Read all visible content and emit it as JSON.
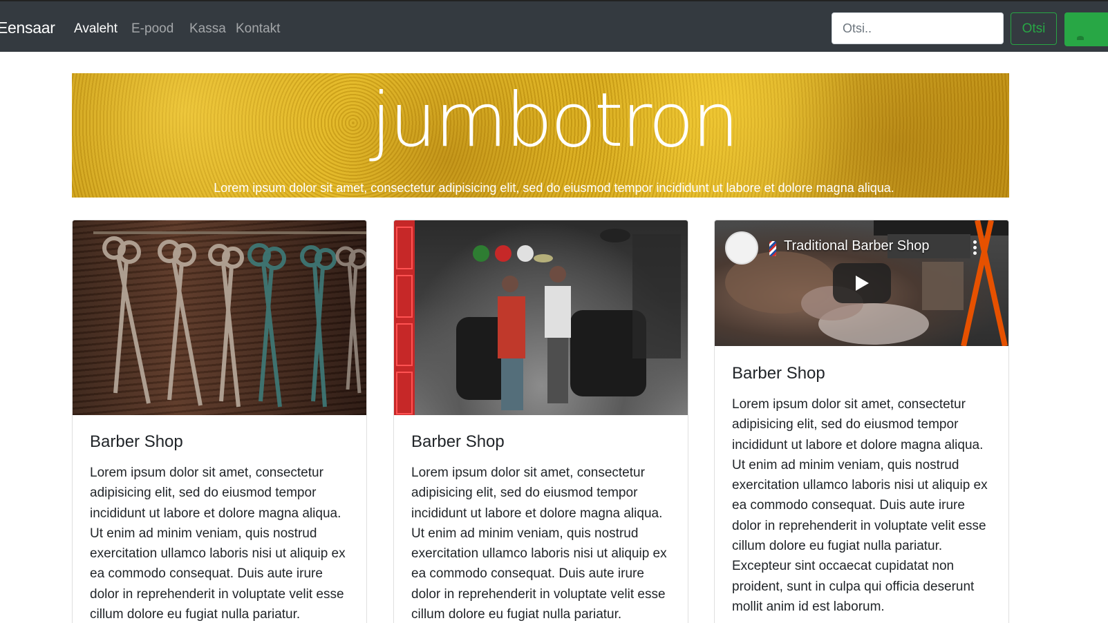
{
  "navbar": {
    "brand": "Eensaar",
    "links": [
      {
        "label": "Avaleht",
        "active": true
      },
      {
        "label": "E-pood",
        "active": false
      },
      {
        "label": "Kassa",
        "active": false
      },
      {
        "label": "Kontakt",
        "active": false
      }
    ],
    "search": {
      "placeholder": "Otsi..",
      "value": ""
    },
    "search_button": "Otsi"
  },
  "jumbotron": {
    "title": "jumbotron",
    "subtitle": "Lorem ipsum dolor sit amet, consectetur adipisicing elit, sed do eiusmod tempor incididunt ut labore et dolore magna aliqua."
  },
  "cards": [
    {
      "media": "image",
      "media_icon": "scissors-image",
      "title": "Barber Shop",
      "text": "Lorem ipsum dolor sit amet, consectetur adipisicing elit, sed do eiusmod tempor incididunt ut labore et dolore magna aliqua. Ut enim ad minim veniam, quis nostrud exercitation ullamco laboris nisi ut aliquip ex ea commodo consequat. Duis aute irure dolor in reprehenderit in voluptate velit esse cillum dolore eu fugiat nulla pariatur."
    },
    {
      "media": "image",
      "media_icon": "barbershop-interior-image",
      "title": "Barber Shop",
      "text": "Lorem ipsum dolor sit amet, consectetur adipisicing elit, sed do eiusmod tempor incididunt ut labore et dolore magna aliqua. Ut enim ad minim veniam, quis nostrud exercitation ullamco laboris nisi ut aliquip ex ea commodo consequat. Duis aute irure dolor in reprehenderit in voluptate velit esse cillum dolore eu fugiat nulla pariatur."
    },
    {
      "media": "video",
      "video_title": "Traditional Barber Shop",
      "title": "Barber Shop",
      "text": "Lorem ipsum dolor sit amet, consectetur adipisicing elit, sed do eiusmod tempor incididunt ut labore et dolore magna aliqua. Ut enim ad minim veniam, quis nostrud exercitation ullamco laboris nisi ut aliquip ex ea commodo consequat. Duis aute irure dolor in reprehenderit in voluptate velit esse cillum dolore eu fugiat nulla pariatur. Excepteur sint occaecat cupidatat non proident, sunt in culpa qui officia deserunt mollit anim id est laborum."
    }
  ],
  "colors": {
    "navbar_bg": "#343a40",
    "success": "#28a745",
    "jumbotron_gold": "#d6a818"
  }
}
